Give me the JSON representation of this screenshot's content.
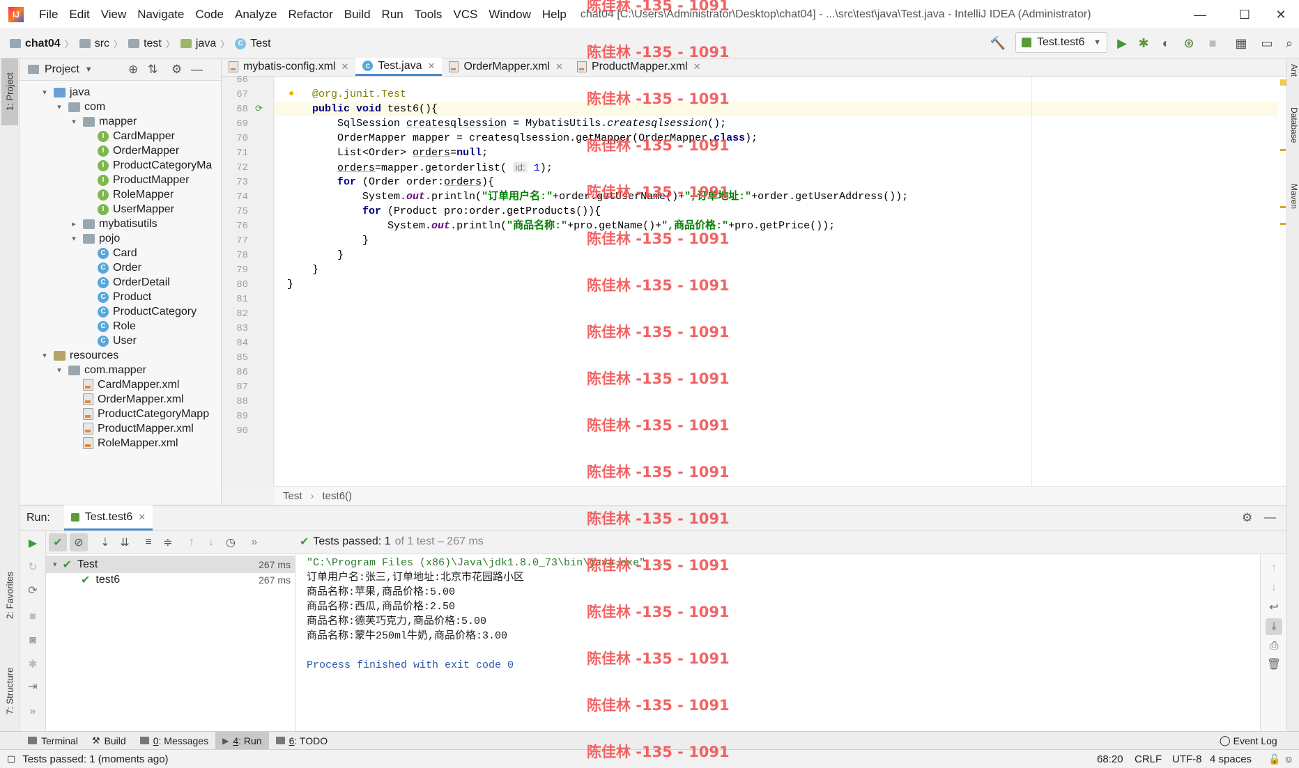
{
  "menubar": {
    "items": [
      "File",
      "Edit",
      "View",
      "Navigate",
      "Code",
      "Analyze",
      "Refactor",
      "Build",
      "Run",
      "Tools",
      "VCS",
      "Window",
      "Help"
    ],
    "window_title": "chat04 [C:\\Users\\Administrator\\Desktop\\chat04] - ...\\src\\test\\java\\Test.java - IntelliJ IDEA (Administrator)"
  },
  "navbar": {
    "crumbs": [
      "chat04",
      "src",
      "test",
      "java",
      "Test"
    ],
    "run_config": "Test.test6"
  },
  "left_stripe": {
    "project": "1: Project",
    "favorites": "2: Favorites",
    "structure": "7: Structure"
  },
  "right_stripe": {
    "ant": "Ant",
    "database": "Database",
    "maven": "Maven"
  },
  "project_panel": {
    "title": "Project",
    "tree": [
      {
        "label": "java",
        "depth": 1,
        "arrow": "▾",
        "icon": "ico-java"
      },
      {
        "label": "com",
        "depth": 2,
        "arrow": "▾",
        "icon": "ico-folder"
      },
      {
        "label": "mapper",
        "depth": 3,
        "arrow": "▾",
        "icon": "ico-folder"
      },
      {
        "label": "CardMapper",
        "depth": 4,
        "arrow": "",
        "icon": "ico-interface"
      },
      {
        "label": "OrderMapper",
        "depth": 4,
        "arrow": "",
        "icon": "ico-interface"
      },
      {
        "label": "ProductCategoryMa",
        "depth": 4,
        "arrow": "",
        "icon": "ico-interface"
      },
      {
        "label": "ProductMapper",
        "depth": 4,
        "arrow": "",
        "icon": "ico-interface"
      },
      {
        "label": "RoleMapper",
        "depth": 4,
        "arrow": "",
        "icon": "ico-interface"
      },
      {
        "label": "UserMapper",
        "depth": 4,
        "arrow": "",
        "icon": "ico-interface"
      },
      {
        "label": "mybatisutils",
        "depth": 3,
        "arrow": "▸",
        "icon": "ico-folder"
      },
      {
        "label": "pojo",
        "depth": 3,
        "arrow": "▾",
        "icon": "ico-folder"
      },
      {
        "label": "Card",
        "depth": 4,
        "arrow": "",
        "icon": "ico-class"
      },
      {
        "label": "Order",
        "depth": 4,
        "arrow": "",
        "icon": "ico-class"
      },
      {
        "label": "OrderDetail",
        "depth": 4,
        "arrow": "",
        "icon": "ico-class"
      },
      {
        "label": "Product",
        "depth": 4,
        "arrow": "",
        "icon": "ico-class"
      },
      {
        "label": "ProductCategory",
        "depth": 4,
        "arrow": "",
        "icon": "ico-class"
      },
      {
        "label": "Role",
        "depth": 4,
        "arrow": "",
        "icon": "ico-class"
      },
      {
        "label": "User",
        "depth": 4,
        "arrow": "",
        "icon": "ico-class"
      },
      {
        "label": "resources",
        "depth": 1,
        "arrow": "▾",
        "icon": "ico-res"
      },
      {
        "label": "com.mapper",
        "depth": 2,
        "arrow": "▾",
        "icon": "ico-folder"
      },
      {
        "label": "CardMapper.xml",
        "depth": 3,
        "arrow": "",
        "icon": "ico-xml"
      },
      {
        "label": "OrderMapper.xml",
        "depth": 3,
        "arrow": "",
        "icon": "ico-xml"
      },
      {
        "label": "ProductCategoryMapp",
        "depth": 3,
        "arrow": "",
        "icon": "ico-xml"
      },
      {
        "label": "ProductMapper.xml",
        "depth": 3,
        "arrow": "",
        "icon": "ico-xml"
      },
      {
        "label": "RoleMapper.xml",
        "depth": 3,
        "arrow": "",
        "icon": "ico-xml"
      }
    ]
  },
  "editor": {
    "tabs": [
      {
        "label": "mybatis-config.xml",
        "kind": "xml",
        "active": false
      },
      {
        "label": "Test.java",
        "kind": "class",
        "active": true
      },
      {
        "label": "OrderMapper.xml",
        "kind": "xml",
        "active": false
      },
      {
        "label": "ProductMapper.xml",
        "kind": "xml",
        "active": false
      }
    ],
    "first_line_number": 66,
    "current_line": 68,
    "lines": [
      "",
      "    <span class=\"ann\">@org.junit.Test</span>",
      "    <span class=\"kw\">public void</span> test6(){",
      "        SqlSession <span class=\"ul\">createsqlsession</span> = MybatisUtils.<span class=\"ital\">createsqlsession</span>();",
      "        OrderMapper mapper = createsqlsession.getMapper(OrderMapper.<span class=\"kw\">class</span>);",
      "        List&lt;Order&gt; <span class=\"ul\">orders</span>=<span class=\"kw\">null</span>;",
      "        <span class=\"ul\">orders</span>=mapper.getorderlist( <span class=\"hint\">id:</span> <span class=\"num\">1</span>);",
      "        <span class=\"kw\">for</span> (Order order:<span class=\"ul\">orders</span>){",
      "            System.<span class=\"fld\">out</span>.println(<span class=\"str\">\"订单用户名:\"</span>+order.getUserName()+<span class=\"str\">\",订单地址:\"</span>+order.getUserAddress());",
      "            <span class=\"kw\">for</span> (Product pro:order.getProducts()){",
      "                System.<span class=\"fld\">out</span>.println(<span class=\"str\">\"商品名称:\"</span>+pro.getName()+<span class=\"str\">\",商品价格:\"</span>+pro.getPrice());",
      "            }",
      "        }",
      "    }",
      "}",
      "",
      "",
      "",
      "",
      "",
      "",
      "",
      "",
      "",
      ""
    ],
    "breadcrumb": [
      "Test",
      "test6()"
    ]
  },
  "watermark": "陈佳林 -135 - 1091",
  "run_panel": {
    "label": "Run:",
    "tab": "Test.test6",
    "status_prefix": "Tests passed:",
    "status_count": "1",
    "status_rest": "of 1 test – 267 ms",
    "tree": [
      {
        "label": "Test",
        "time": "267 ms",
        "indent": 0,
        "selected": true
      },
      {
        "label": "test6",
        "time": "267 ms",
        "indent": 1,
        "selected": false
      }
    ],
    "console": [
      {
        "text": "\"C:\\Program Files (x86)\\Java\\jdk1.8.0_73\\bin\\java.exe\" ...",
        "kind": "cmd"
      },
      {
        "text": "订单用户名:张三,订单地址:北京市花园路小区",
        "kind": "out"
      },
      {
        "text": "商品名称:苹果,商品价格:5.00",
        "kind": "out"
      },
      {
        "text": "商品名称:西瓜,商品价格:2.50",
        "kind": "out"
      },
      {
        "text": "商品名称:德芙巧克力,商品价格:5.00",
        "kind": "out"
      },
      {
        "text": "商品名称:蒙牛250ml牛奶,商品价格:3.00",
        "kind": "out"
      },
      {
        "text": "",
        "kind": "out"
      },
      {
        "text": "Process finished with exit code 0",
        "kind": "fin"
      }
    ]
  },
  "tool_tabs": {
    "terminal": "Terminal",
    "build": "Build",
    "messages_num": "0",
    "messages": ": Messages",
    "run_num": "4",
    "run": ": Run",
    "todo_num": "6",
    "todo": ": TODO",
    "event_log": "Event Log"
  },
  "statusbar": {
    "message": "Tests passed: 1 (moments ago)",
    "position": "68:20",
    "line_sep": "CRLF",
    "encoding": "UTF-8",
    "indent": "4 spaces"
  }
}
